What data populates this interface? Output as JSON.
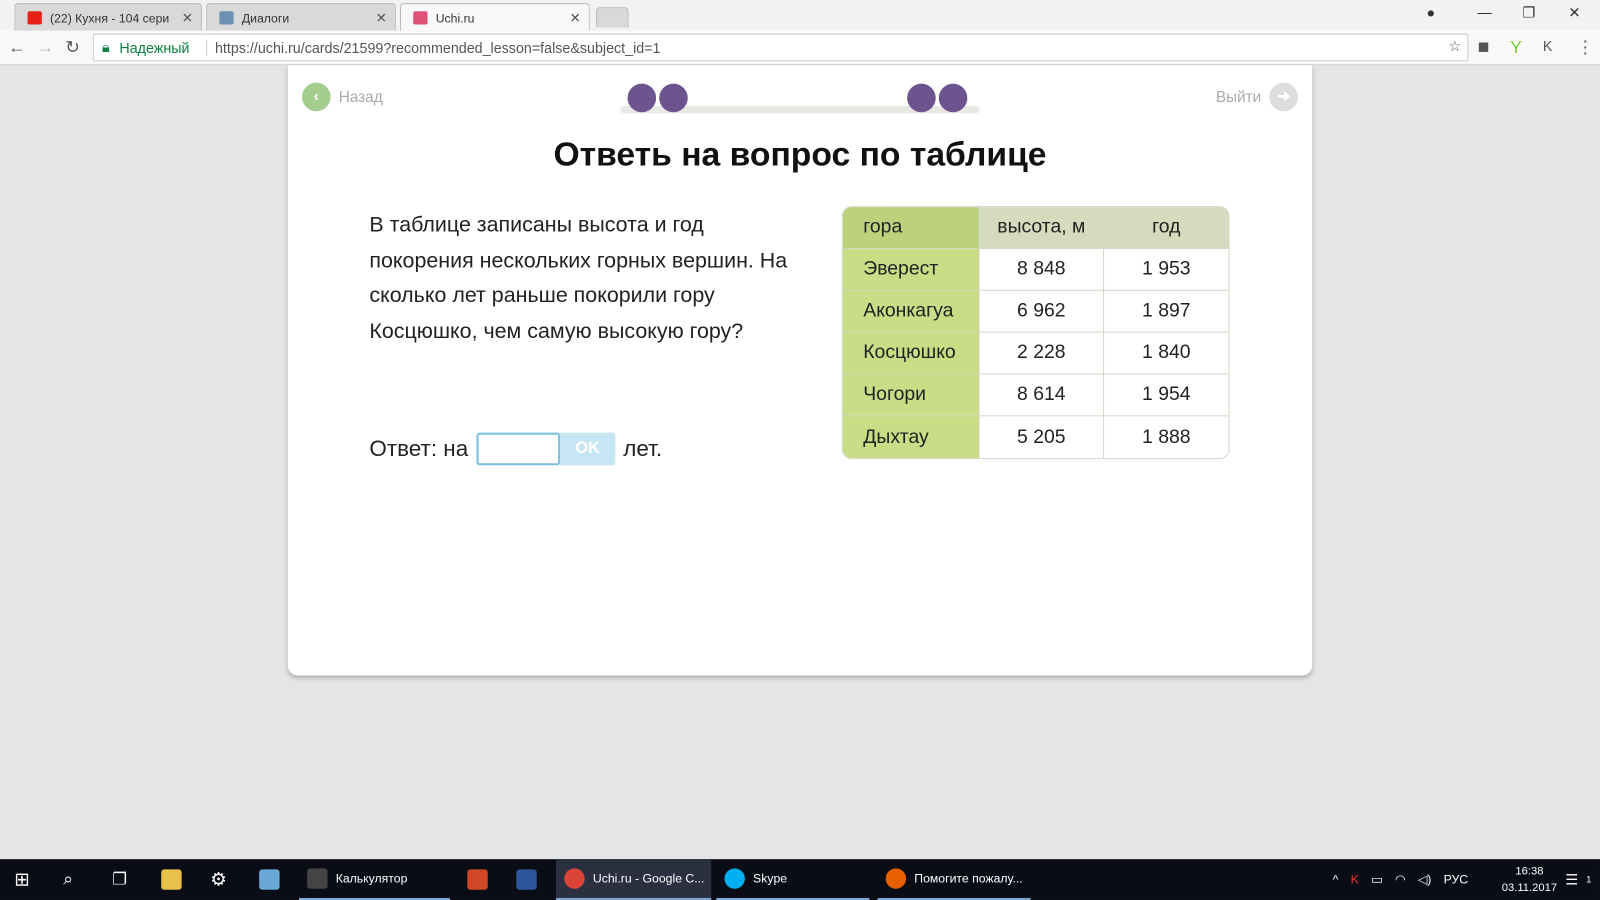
{
  "browser": {
    "tabs": [
      {
        "label": "(22) Кухня - 104 сери",
        "color": "#e62117"
      },
      {
        "label": "Диалоги",
        "color": "#6d8fb3"
      },
      {
        "label": "Uchi.ru",
        "color": "#e0517a"
      }
    ],
    "secure_label": "Надежный",
    "url": "https://uchi.ru/cards/21599?recommended_lesson=false&subject_id=1"
  },
  "page": {
    "back_label": "Назад",
    "exit_label": "Выйти",
    "title": "Ответь на вопрос по таблице",
    "question": "В таблице записаны высота и год покорения нескольких горных вершин. На сколько лет раньше покорили гору Косцюшко, чем самую высокую гору?",
    "answer_prefix": "Ответ: на",
    "answer_value": "",
    "ok_label": "OK",
    "answer_suffix": "лет.",
    "table": {
      "headers": [
        "гора",
        "высота, м",
        "год"
      ],
      "rows": [
        [
          "Эверест",
          "8 848",
          "1 953"
        ],
        [
          "Аконкагуа",
          "6 962",
          "1 897"
        ],
        [
          "Косцюшко",
          "2 228",
          "1 840"
        ],
        [
          "Чогори",
          "8 614",
          "1 954"
        ],
        [
          "Дыхтау",
          "5 205",
          "1 888"
        ]
      ]
    }
  },
  "taskbar": {
    "apps": [
      "Калькулятор",
      "Uchi.ru - Google C...",
      "Skype",
      "Помогите пожалу..."
    ],
    "lang": "РУС",
    "time": "16:38",
    "date": "03.11.2017",
    "notif_count": "1"
  }
}
